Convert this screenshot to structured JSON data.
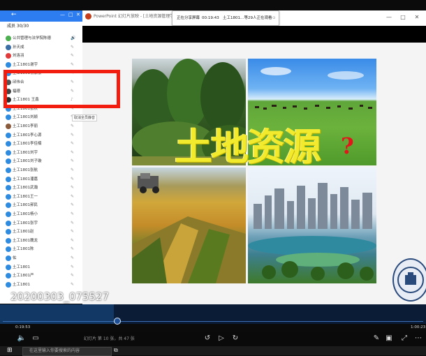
{
  "ppt": {
    "title": "PowerPoint 幻灯片放映 - [土地资源管理学-第一章",
    "minimize": "—",
    "maximize": "□",
    "close": "✕"
  },
  "share_bar": {
    "label": "正在分享屏幕",
    "time": "00:19:43",
    "viewers": "土工1801…等29人正在观看",
    "badge": "⊙"
  },
  "slide": {
    "title": "土地资源",
    "question_mark": "?"
  },
  "panel": {
    "count": "成员 30/30",
    "tooltip": "取消全员静音",
    "participants": [
      {
        "name": "公共管理与法学院陈德",
        "color": "#4caf50",
        "mic": "🔊"
      },
      {
        "name": "孙天成",
        "color": "#3a6ea5",
        "mic": "✎"
      },
      {
        "name": "刘洛羽",
        "color": "#e03a3a",
        "mic": "✎"
      },
      {
        "name": "土工1801谢宇",
        "color": "#2e8be0",
        "mic": "✎"
      },
      {
        "name": "土工1801杨家豪",
        "color": "#2e8be0",
        "mic": "✎"
      },
      {
        "name": "邱伟合",
        "color": "#555555",
        "mic": "✎"
      },
      {
        "name": "福德",
        "color": "#444444",
        "mic": "✎"
      },
      {
        "name": "土工1801 王鑫",
        "color": "#2d2d2d",
        "mic": "♪"
      },
      {
        "name": "土工1801张秋",
        "color": "#2e8be0",
        "mic": "✎"
      },
      {
        "name": "土工1801刘颖",
        "color": "#2e8be0",
        "mic": "✎"
      },
      {
        "name": "土工1801李丽",
        "color": "#8a5a3c",
        "mic": "✎"
      },
      {
        "name": "土工1801李心源",
        "color": "#2e8be0",
        "mic": "✎"
      },
      {
        "name": "土工1801李佳楠",
        "color": "#2e8be0",
        "mic": "✎"
      },
      {
        "name": "土工1801刘宇",
        "color": "#2e8be0",
        "mic": "✎"
      },
      {
        "name": "土工1801刘子璇",
        "color": "#2e8be0",
        "mic": "✎"
      },
      {
        "name": "土工1801张航",
        "color": "#2e8be0",
        "mic": "✎"
      },
      {
        "name": "土工1801潘嘉",
        "color": "#2e8be0",
        "mic": "✎"
      },
      {
        "name": "土工1801武瀚",
        "color": "#2e8be0",
        "mic": "✎"
      },
      {
        "name": "土工1801王一",
        "color": "#2e8be0",
        "mic": "✎"
      },
      {
        "name": "土工1801郝民",
        "color": "#2e8be0",
        "mic": "✎"
      },
      {
        "name": "土工1801杨小",
        "color": "#2e8be0",
        "mic": "✎"
      },
      {
        "name": "土工1801张宇",
        "color": "#2e8be0",
        "mic": "✎"
      },
      {
        "name": "土工1801赵",
        "color": "#2e8be0",
        "mic": "✎"
      },
      {
        "name": "土工1801魏龙",
        "color": "#2e8be0",
        "mic": "✎"
      },
      {
        "name": "土工1801陈",
        "color": "#2e8be0",
        "mic": "✎"
      },
      {
        "name": "佑",
        "color": "#2e8be0",
        "mic": "✎"
      },
      {
        "name": "土工1801",
        "color": "#2e8be0",
        "mic": "✎"
      },
      {
        "name": "土工1801严",
        "color": "#2e8be0",
        "mic": "✎"
      },
      {
        "name": "土工1801",
        "color": "#2e8be0",
        "mic": "✎"
      }
    ]
  },
  "video": {
    "filename": "20200303_075527",
    "elapsed": "0:19:53",
    "total": "1:00:23",
    "progress": 0.27
  },
  "ppt_status": "幻灯片 第 10 张，共 47 张",
  "taskbar": {
    "search_placeholder": "在这里输入你要搜索的内容"
  },
  "colors": {
    "highlight": "#f21d0f",
    "title_yellow": "#f2ea2c",
    "accent_blue": "#2d7df0"
  }
}
